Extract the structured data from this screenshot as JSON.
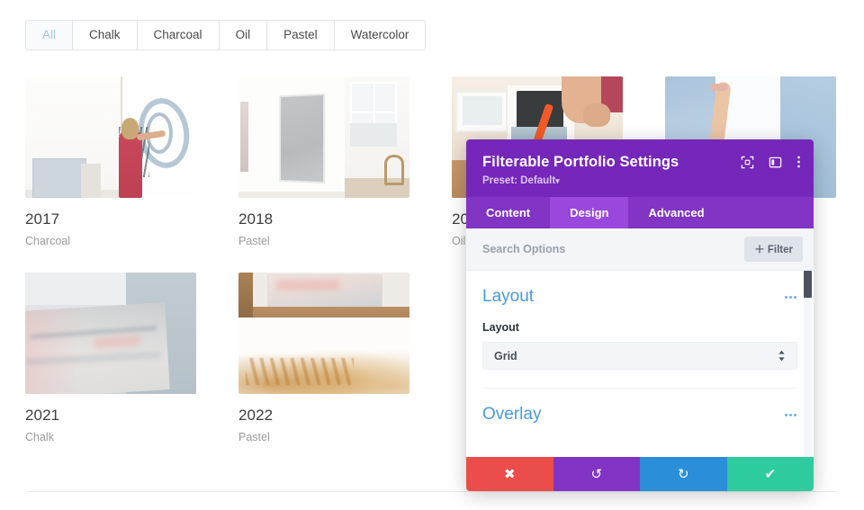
{
  "filter_bar": {
    "tabs": [
      {
        "label": "All",
        "active": true
      },
      {
        "label": "Chalk",
        "active": false
      },
      {
        "label": "Charcoal",
        "active": false
      },
      {
        "label": "Oil",
        "active": false
      },
      {
        "label": "Pastel",
        "active": false
      },
      {
        "label": "Watercolor",
        "active": false
      }
    ]
  },
  "portfolio": {
    "items": [
      {
        "title": "2017",
        "category": "Charcoal",
        "art": "art1"
      },
      {
        "title": "2018",
        "category": "Pastel",
        "art": "art2"
      },
      {
        "title": "20",
        "category": "Oil",
        "art": "art3"
      },
      {
        "title": "",
        "category": "",
        "art": "art4"
      },
      {
        "title": "2021",
        "category": "Chalk",
        "art": "art5"
      },
      {
        "title": "2022",
        "category": "Pastel",
        "art": "art6"
      }
    ]
  },
  "settings": {
    "title": "Filterable Portfolio Settings",
    "preset_label": "Preset: Default",
    "preset_caret": "▾",
    "header_icons": [
      {
        "name": "focus-icon"
      },
      {
        "name": "panel-layout-icon"
      },
      {
        "name": "more-options-icon"
      }
    ],
    "tabs": [
      {
        "label": "Content",
        "active": false
      },
      {
        "label": "Design",
        "active": true
      },
      {
        "label": "Advanced",
        "active": false
      }
    ],
    "search": {
      "value": "",
      "placeholder": "Search Options"
    },
    "filter_button": "＋ Filter",
    "sections": [
      {
        "title": "Layout",
        "field_label": "Layout",
        "field_value": "Grid"
      },
      {
        "title": "Overlay"
      }
    ],
    "actions": [
      {
        "name": "cancel-button",
        "glyph": "✖"
      },
      {
        "name": "undo-button",
        "glyph": "↺"
      },
      {
        "name": "redo-button",
        "glyph": "↻"
      },
      {
        "name": "save-button",
        "glyph": "✔"
      }
    ],
    "colors": {
      "header": "#7527ba",
      "tabbar": "#8234c4",
      "tab_active": "#9a48db",
      "section_title": "#4a9ade",
      "cancel": "#eb4d4b",
      "undo": "#8234c4",
      "redo": "#2a8fd8",
      "save": "#2ecc9e"
    }
  }
}
